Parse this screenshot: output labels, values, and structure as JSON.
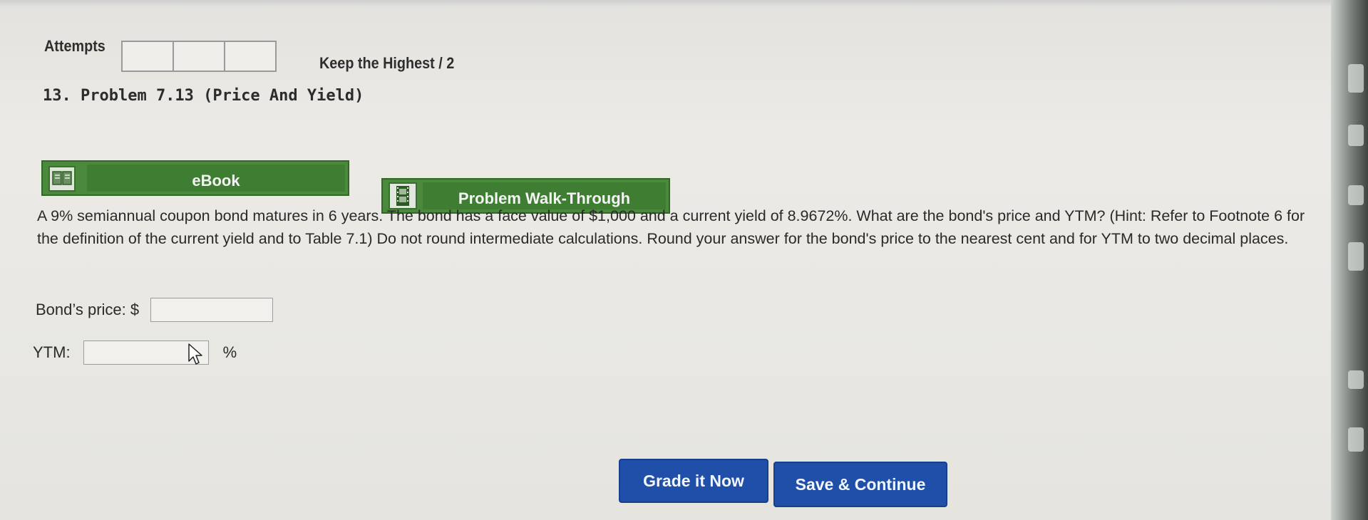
{
  "attempts": {
    "label": "Attempts",
    "box_count": 3,
    "keep_highest": "Keep the Highest / 2"
  },
  "problem": {
    "title": "13. Problem 7.13 (Price And Yield)"
  },
  "resources": {
    "ebook_label": "eBook",
    "ebook_icon": "book-icon",
    "walkthrough_label": "Problem Walk-Through",
    "walkthrough_icon": "film-icon"
  },
  "question": {
    "text": "A 9% semiannual coupon bond matures in 6 years. The bond has a face value of $1,000 and a current yield of 8.9672%. What are the bond's price and YTM? (Hint: Refer to Footnote 6 for the definition of the current yield and to Table 7.1) Do not round intermediate calculations. Round your answer for the bond's price to the nearest cent and for YTM to two decimal places."
  },
  "answers": {
    "price_label": "Bond’s price: $",
    "price_value": "",
    "ytm_label": "YTM:",
    "ytm_value": "",
    "ytm_unit": "%"
  },
  "actions": {
    "grade_label": "Grade it Now",
    "save_label": "Save & Continue"
  },
  "colors": {
    "resource_green": "#4b8a3c",
    "action_blue": "#1f4fa8"
  }
}
